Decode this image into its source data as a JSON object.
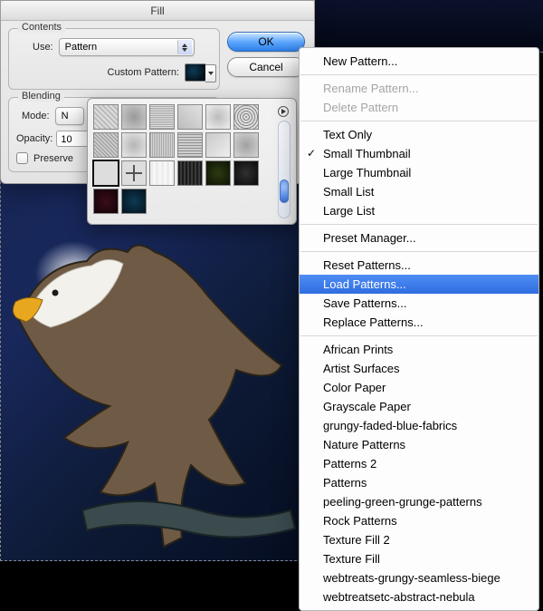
{
  "dialog": {
    "title": "Fill",
    "contents": {
      "group_label": "Contents",
      "use_label": "Use:",
      "use_value": "Pattern",
      "custom_pattern_label": "Custom Pattern:"
    },
    "blending": {
      "group_label": "Blending",
      "mode_label": "Mode:",
      "mode_value_abbrev": "N",
      "opacity_label": "Opacity:",
      "opacity_value": "10",
      "preserve_label": "Preserve"
    },
    "buttons": {
      "ok": "OK",
      "cancel": "Cancel"
    }
  },
  "menu": {
    "groups": [
      {
        "items": [
          {
            "label": "New Pattern...",
            "enabled": true
          }
        ]
      },
      {
        "items": [
          {
            "label": "Rename Pattern...",
            "enabled": false
          },
          {
            "label": "Delete Pattern",
            "enabled": false
          }
        ]
      },
      {
        "items": [
          {
            "label": "Text Only",
            "enabled": true
          },
          {
            "label": "Small Thumbnail",
            "enabled": true,
            "checked": true
          },
          {
            "label": "Large Thumbnail",
            "enabled": true
          },
          {
            "label": "Small List",
            "enabled": true
          },
          {
            "label": "Large List",
            "enabled": true
          }
        ]
      },
      {
        "items": [
          {
            "label": "Preset Manager...",
            "enabled": true
          }
        ]
      },
      {
        "items": [
          {
            "label": "Reset Patterns...",
            "enabled": true
          },
          {
            "label": "Load Patterns...",
            "enabled": true,
            "selected": true
          },
          {
            "label": "Save Patterns...",
            "enabled": true
          },
          {
            "label": "Replace Patterns...",
            "enabled": true
          }
        ]
      },
      {
        "items": [
          {
            "label": "African Prints",
            "enabled": true
          },
          {
            "label": "Artist Surfaces",
            "enabled": true
          },
          {
            "label": "Color Paper",
            "enabled": true
          },
          {
            "label": "Grayscale Paper",
            "enabled": true
          },
          {
            "label": "grungy-faded-blue-fabrics",
            "enabled": true
          },
          {
            "label": "Nature Patterns",
            "enabled": true
          },
          {
            "label": "Patterns 2",
            "enabled": true
          },
          {
            "label": "Patterns",
            "enabled": true
          },
          {
            "label": "peeling-green-grunge-patterns",
            "enabled": true
          },
          {
            "label": "Rock Patterns",
            "enabled": true
          },
          {
            "label": "Texture Fill 2",
            "enabled": true
          },
          {
            "label": "Texture Fill",
            "enabled": true
          },
          {
            "label": "webtreats-grungy-seamless-biege",
            "enabled": true
          },
          {
            "label": "webtreatsetc-abstract-nebula",
            "enabled": true
          }
        ]
      }
    ]
  },
  "pattern_swatches": [
    {
      "bg": "repeating-linear-gradient(45deg,#bbb,#bbb 2px,#ddd 2px,#ddd 4px)"
    },
    {
      "bg": "radial-gradient(#999,#ccc)"
    },
    {
      "bg": "repeating-linear-gradient(0deg,#aaa,#aaa 1px,#ddd 1px,#ddd 2px)"
    },
    {
      "bg": "linear-gradient(45deg,#bcbcbc,#e2e2e2)"
    },
    {
      "bg": "radial-gradient(#bcbcbc,#efefef)"
    },
    {
      "bg": "repeating-radial-gradient(#888,#888 1px,#ddd 1px,#ddd 3px)"
    },
    {
      "bg": "repeating-linear-gradient(45deg,#999,#999 1px,#ccc 1px,#ccc 3px)"
    },
    {
      "bg": "radial-gradient(#b5b5b5,#e8e8e8)"
    },
    {
      "bg": "repeating-linear-gradient(90deg,#a8a8a8,#a8a8a8 1px,#d8d8d8 1px,#d8d8d8 2px)"
    },
    {
      "bg": "repeating-linear-gradient(0deg,#8f8f8f,#8f8f8f 1px,#cfcfcf 1px,#cfcfcf 3px)"
    },
    {
      "bg": "linear-gradient(135deg,#c9c9c9,#eee)"
    },
    {
      "bg": "radial-gradient(#a0a0a0,#d4d4d4)"
    },
    {
      "bg": "#dddddd",
      "selected": true
    },
    {
      "bg": "linear-gradient(#ddd,#ddd),linear-gradient(90deg,#888,#888)",
      "plus": true
    },
    {
      "bg": "repeating-linear-gradient(90deg,#ededed,#ededed 3px,#f7f7f7 3px,#f7f7f7 6px)"
    },
    {
      "bg": "repeating-linear-gradient(90deg,#1b1b1b,#1b1b1b 2px,#3a3a3a 2px,#3a3a3a 4px)"
    },
    {
      "bg": "radial-gradient(#2c3a12,#0d1304)"
    },
    {
      "bg": "radial-gradient(#303030,#0a0a0a)"
    },
    {
      "bg": "radial-gradient(#3a0d18,#120307)"
    },
    {
      "bg": "radial-gradient(#0e3a52,#04131d)"
    }
  ]
}
